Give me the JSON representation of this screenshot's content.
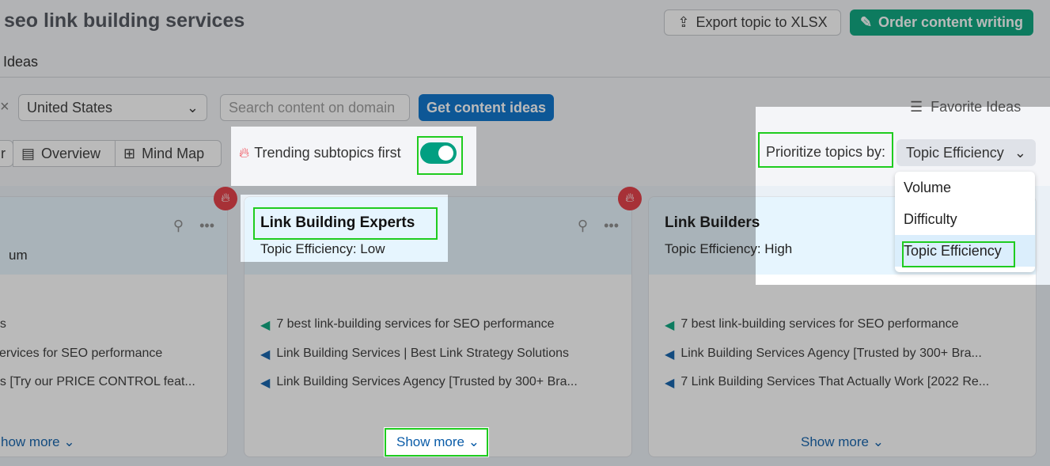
{
  "header": {
    "title": "seo link building services",
    "export_label": "Export topic to XLSX",
    "order_label": "Order content writing",
    "tab": "Ideas"
  },
  "filters": {
    "country": "United States",
    "search_placeholder": "Search content on domain",
    "get_ideas": "Get content ideas",
    "favorite": "Favorite Ideas"
  },
  "views": {
    "partial": "r",
    "overview": "Overview",
    "mindmap": "Mind Map"
  },
  "trending": {
    "label": "Trending subtopics first",
    "enabled": true
  },
  "prioritize": {
    "label": "Prioritize topics by:",
    "selected": "Topic Efficiency",
    "options": [
      "Volume",
      "Difficulty",
      "Topic Efficiency"
    ]
  },
  "cards": [
    {
      "title": "",
      "sub": "um",
      "items": [
        "es",
        "services for SEO performance",
        "es [Try our PRICE CONTROL feat..."
      ],
      "more": "how more"
    },
    {
      "title": "Link Building Experts",
      "sub": "Topic Efficiency: Low",
      "items": [
        "7 best link-building services for SEO performance",
        "Link Building Services | Best Link Strategy Solutions",
        "Link Building Services Agency [Trusted by 300+ Bra..."
      ],
      "more": "Show more"
    },
    {
      "title": "Link Builders",
      "sub": "Topic Efficiency: High",
      "items": [
        "7 best link-building services for SEO performance",
        "Link Building Services Agency [Trusted by 300+ Bra...",
        "7 Link Building Services That Actually Work [2022 Re..."
      ],
      "more": "Show more"
    }
  ],
  "colors": {
    "accent_green": "#00a37a",
    "accent_blue": "#006dca",
    "highlight": "#1fcc1f"
  }
}
